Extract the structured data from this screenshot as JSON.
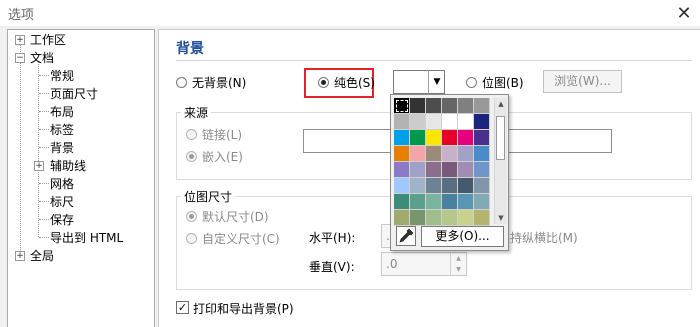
{
  "window": {
    "title": "选项",
    "close_icon": "close-icon"
  },
  "tree": {
    "items": [
      {
        "label": "工作区",
        "expander": "+"
      },
      {
        "label": "文档",
        "expander": "−"
      },
      {
        "label": "常规"
      },
      {
        "label": "页面尺寸"
      },
      {
        "label": "布局"
      },
      {
        "label": "标签"
      },
      {
        "label": "背景"
      },
      {
        "label": "辅助线",
        "expander": "+"
      },
      {
        "label": "网格"
      },
      {
        "label": "标尺"
      },
      {
        "label": "保存"
      },
      {
        "label": "导出到 HTML"
      },
      {
        "label": "全局",
        "expander": "+"
      }
    ]
  },
  "panel": {
    "title": "背景",
    "options": {
      "no_background": "无背景(N)",
      "solid": "纯色(S)",
      "bitmap": "位图(B)",
      "browse": "浏览(W)..."
    },
    "source": {
      "title": "来源",
      "link": "链接(L)",
      "embed": "嵌入(E)"
    },
    "bitmap_size": {
      "title": "位图尺寸",
      "default": "默认尺寸(D)",
      "custom": "自定义尺寸(C)",
      "horizontal": "水平(H):",
      "vertical": "垂直(V):",
      "h_value": ".0",
      "v_value": ".0",
      "keep_ratio": "保持纵横比(M)"
    },
    "print_export": "打印和导出背景(P)"
  },
  "palette": {
    "selected_color": "#ffffff",
    "more_label": "更多(O)...",
    "eyedropper_icon": "eyedropper-icon",
    "swatches": [
      "#000000",
      "#333333",
      "#4d4d4d",
      "#666666",
      "#808080",
      "#999999",
      "#b3b3b3",
      "#cccccc",
      "#e6e6e6",
      "#ffffff",
      "#ffffff",
      "#1a237e",
      "#00a0e6",
      "#00994c",
      "#ffe600",
      "#e6002a",
      "#e6007e",
      "#4a2f8c",
      "#e67e00",
      "#f5a5a5",
      "#9e8a7a",
      "#c8b0c8",
      "#a0a0c8",
      "#4a8cc8",
      "#8c7ac8",
      "#a0a0c8",
      "#8c6e8c",
      "#7a5a7a",
      "#a08cb4",
      "#6e96c8",
      "#a0c8ff",
      "#a0b4c8",
      "#6e8296",
      "#5a6e82",
      "#465a6e",
      "#8296aa",
      "#3c8c78",
      "#5aa08c",
      "#78b4a0",
      "#4682a0",
      "#5a96b4",
      "#82aab4",
      "#a0aa6e",
      "#78966e",
      "#a0be8c",
      "#b4c88c",
      "#c8d28c",
      "#b4b46e"
    ]
  }
}
